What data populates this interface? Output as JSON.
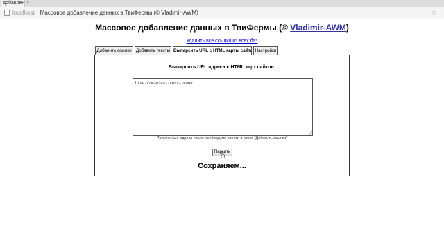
{
  "browser": {
    "tab_title": "добавлен",
    "tab_close": "×",
    "address_host": "localhost",
    "address_sep": "|",
    "address_title": "Массовое добавление данных в ТвиФермы (© Vladimir-AWM)",
    "star": "☆"
  },
  "page": {
    "title_main": "Массовое добавление данных в ТвиФермы (© ",
    "title_link": "Vladimir-AWM",
    "title_end": ")",
    "delete_link": "Удалить все ссылки из всех баз"
  },
  "tabs": [
    "Добавить ссылки",
    "Добавить тексты",
    "Выпарсить URL с HTML карты сайта",
    "Настройки"
  ],
  "form": {
    "heading": "Выпарсить URL адреса с HTML карт сайтов:",
    "textarea_value": "http://minjust.ru/sitemap",
    "hint": "Полученные адреса после необходимо ввести в меню \"Добавить ссылки\"",
    "parse_button": "Парсить",
    "status": "Сохраняем..."
  }
}
